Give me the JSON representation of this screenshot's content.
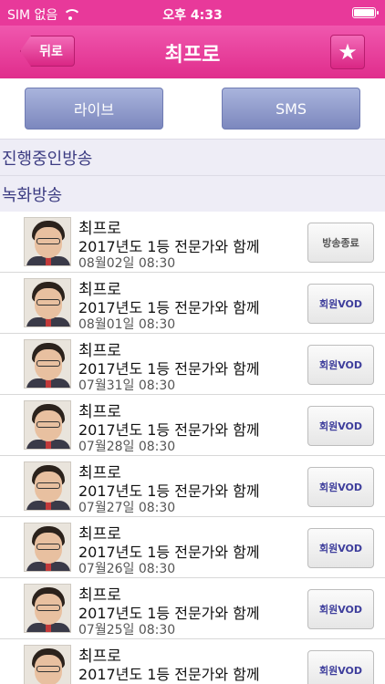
{
  "status_bar": {
    "carrier": "SIM 없음",
    "time": "오후 4:33",
    "battery_level": 1.0
  },
  "nav": {
    "back_label": "뒤로",
    "title": "최프로",
    "favorite_icon": "star-icon"
  },
  "tabs": {
    "live_label": "라이브",
    "sms_label": "SMS"
  },
  "sections": {
    "live_header": "진행중인방송",
    "recorded_header": "녹화방송"
  },
  "broadcasts": [
    {
      "name": "최프로",
      "subtitle": "2017년도 1등 전문가와 함께",
      "date": "08월02일 08:30",
      "button": "방송종료",
      "button_type": "end"
    },
    {
      "name": "최프로",
      "subtitle": "2017년도 1등 전문가와 함께",
      "date": "08월01일 08:30",
      "button": "회원VOD",
      "button_type": "vod"
    },
    {
      "name": "최프로",
      "subtitle": "2017년도 1등 전문가와 함께",
      "date": "07월31일 08:30",
      "button": "회원VOD",
      "button_type": "vod"
    },
    {
      "name": "최프로",
      "subtitle": "2017년도 1등 전문가와 함께",
      "date": "07월28일 08:30",
      "button": "회원VOD",
      "button_type": "vod"
    },
    {
      "name": "최프로",
      "subtitle": "2017년도 1등 전문가와 함께",
      "date": "07월27일 08:30",
      "button": "회원VOD",
      "button_type": "vod"
    },
    {
      "name": "최프로",
      "subtitle": "2017년도 1등 전문가와 함께",
      "date": "07월26일 08:30",
      "button": "회원VOD",
      "button_type": "vod"
    },
    {
      "name": "최프로",
      "subtitle": "2017년도 1등 전문가와 함께",
      "date": "07월25일 08:30",
      "button": "회원VOD",
      "button_type": "vod"
    },
    {
      "name": "최프로",
      "subtitle": "2017년도 1등 전문가와 함께",
      "date": "",
      "button": "회원VOD",
      "button_type": "vod"
    }
  ],
  "colors": {
    "brand_pink": "#e8399a",
    "tab_blue": "#8c97c9",
    "section_text": "#3c3c82",
    "vod_text": "#3e3e9c"
  }
}
